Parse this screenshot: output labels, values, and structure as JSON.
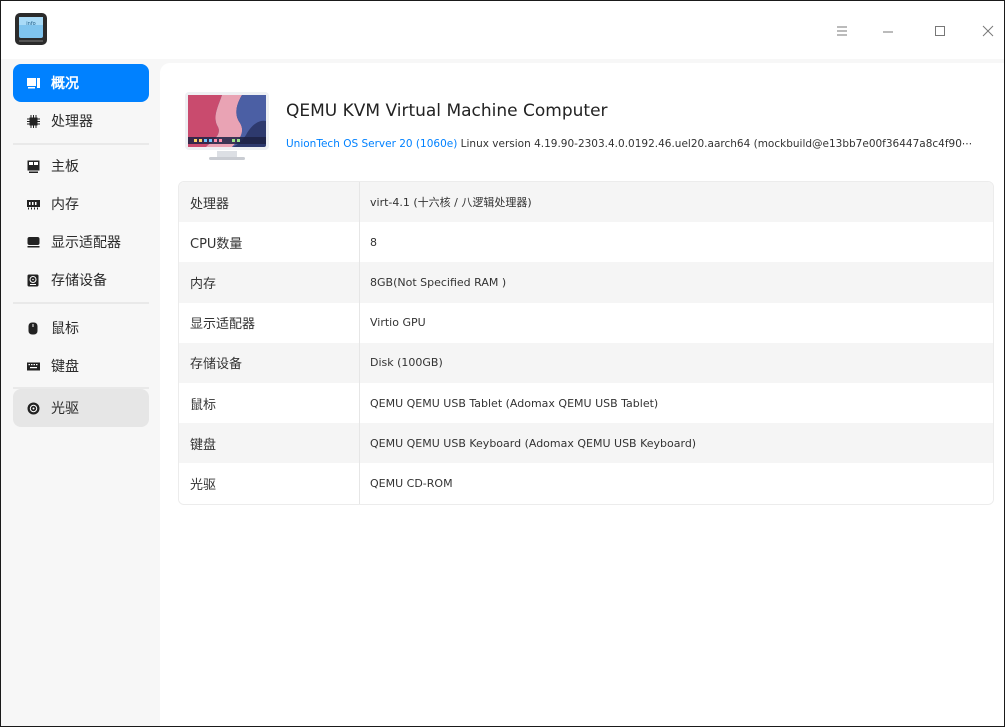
{
  "app": {
    "icon": "device-manager-app-icon",
    "icon_text": "info"
  },
  "titlebar": {
    "menu_icon": "menu-icon",
    "minimize_icon": "minimize-icon",
    "maximize_icon": "maximize-icon",
    "close_icon": "close-icon"
  },
  "sidebar": {
    "items": [
      {
        "label": "概况",
        "icon": "overview-icon",
        "active": true
      },
      {
        "label": "处理器",
        "icon": "cpu-icon"
      },
      {
        "label": "主板",
        "icon": "motherboard-icon"
      },
      {
        "label": "内存",
        "icon": "memory-icon"
      },
      {
        "label": "显示适配器",
        "icon": "display-adapter-icon"
      },
      {
        "label": "存储设备",
        "icon": "storage-icon"
      },
      {
        "label": "鼠标",
        "icon": "mouse-icon"
      },
      {
        "label": "键盘",
        "icon": "keyboard-icon"
      },
      {
        "label": "光驱",
        "icon": "optical-drive-icon",
        "hovered": true
      }
    ]
  },
  "overview": {
    "title": "QEMU KVM Virtual Machine Computer",
    "os_name": "UnionTech OS Server 20 (1060e)",
    "os_detail": " Linux version 4.19.90-2303.4.0.0192.46.uel20.aarch64 (mockbuild@e13bb7e00f36447a8c4f90⋯"
  },
  "info_table": {
    "rows": [
      {
        "key": "处理器",
        "value": "virt-4.1 (十六核 / 八逻辑处理器)"
      },
      {
        "key": "CPU数量",
        "value": "8"
      },
      {
        "key": "内存",
        "value": "8GB(Not Specified RAM )"
      },
      {
        "key": "显示适配器",
        "value": "Virtio GPU"
      },
      {
        "key": "存储设备",
        "value": "Disk (100GB)"
      },
      {
        "key": "鼠标",
        "value": "QEMU QEMU USB Tablet (Adomax QEMU USB Tablet)"
      },
      {
        "key": "键盘",
        "value": "QEMU QEMU USB Keyboard (Adomax QEMU USB Keyboard)"
      },
      {
        "key": "光驱",
        "value": "QEMU CD-ROM"
      }
    ]
  },
  "colors": {
    "accent": "#0081ff",
    "window_bg": "#f7f7f7",
    "panel_bg": "#ffffff"
  }
}
